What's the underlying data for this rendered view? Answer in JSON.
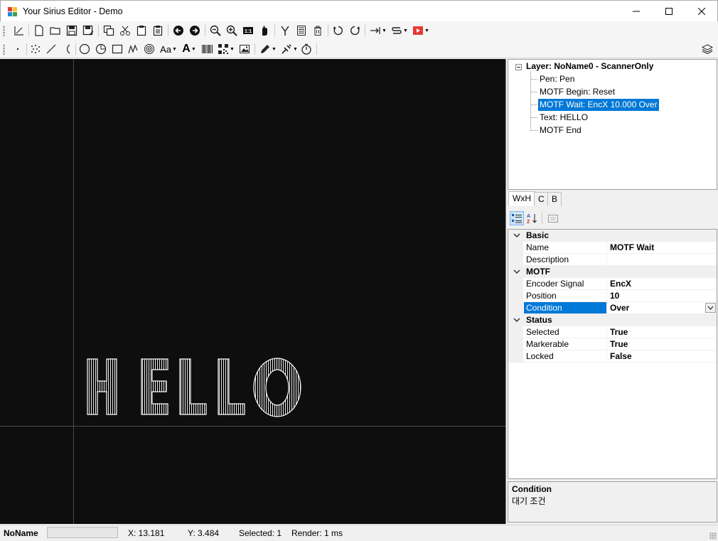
{
  "window": {
    "title": "Your Sirius Editor - Demo",
    "minimize_glyph": "—",
    "maximize_glyph": "☐",
    "close_glyph": "✕"
  },
  "toolbar1": {
    "icons": [
      "draw-mode-icon",
      "new-file-icon",
      "open-folder-icon",
      "save-icon",
      "save-as-icon",
      "copy-icon",
      "cut-icon",
      "paste-icon",
      "paste-array-icon",
      "arrow-left-circle-icon",
      "arrow-right-circle-icon",
      "zoom-out-icon",
      "zoom-in-icon",
      "zoom-1to1-icon",
      "pan-hand-icon",
      "merge-icon",
      "document-list-icon",
      "delete-icon",
      "rotate-ccw-icon",
      "rotate-cw-icon",
      "align-icon",
      "path-icon",
      "record-icon"
    ]
  },
  "toolbar2": {
    "font_label": "Aa",
    "text_label": "A",
    "icons": [
      "point-icon",
      "point-cloud-icon",
      "line-icon",
      "arc-icon",
      "circle-icon",
      "pie-icon",
      "rectangle-icon",
      "spiral-icon",
      "nested-circles-icon",
      "font-icon",
      "text-icon",
      "barcode-icon",
      "qrcode-icon",
      "image-icon",
      "pen-icon",
      "laser-icon",
      "timer-icon",
      "layers-icon"
    ]
  },
  "tree": {
    "root": "Layer: NoName0 - ScannerOnly",
    "items": [
      {
        "label": "Pen: Pen"
      },
      {
        "label": "MOTF Begin: Reset"
      },
      {
        "label": "MOTF Wait: EncX 10.000 Over"
      },
      {
        "label": "Text: HELLO"
      },
      {
        "label": "MOTF End"
      }
    ],
    "selected_index": 2
  },
  "tabs": [
    "WxH",
    "C",
    "B"
  ],
  "property_toolbar": {
    "icons": [
      "categorized-icon",
      "alphabetical-sort-icon",
      "property-pages-icon"
    ]
  },
  "properties": {
    "categories": [
      {
        "name": "Basic",
        "rows": [
          {
            "name": "Name",
            "value": "MOTF Wait"
          },
          {
            "name": "Description",
            "value": ""
          }
        ]
      },
      {
        "name": "MOTF",
        "rows": [
          {
            "name": "Encoder Signal",
            "value": "EncX"
          },
          {
            "name": "Position",
            "value": "10"
          },
          {
            "name": "Condition",
            "value": "Over"
          }
        ]
      },
      {
        "name": "Status",
        "rows": [
          {
            "name": "Selected",
            "value": "True"
          },
          {
            "name": "Markerable",
            "value": "True"
          },
          {
            "name": "Locked",
            "value": "False"
          }
        ]
      }
    ]
  },
  "description": {
    "title": "Condition",
    "text": "대기 조건"
  },
  "canvas": {
    "text": "HELLO",
    "background": "#0e0e0e",
    "stroke": "#ffffff"
  },
  "status": {
    "doc_name": "NoName",
    "x": "X: 13.181",
    "y": "Y: 3.484",
    "selected": "Selected: 1",
    "render": "Render: 1 ms"
  },
  "colors": {
    "selection": "#0078d7"
  }
}
